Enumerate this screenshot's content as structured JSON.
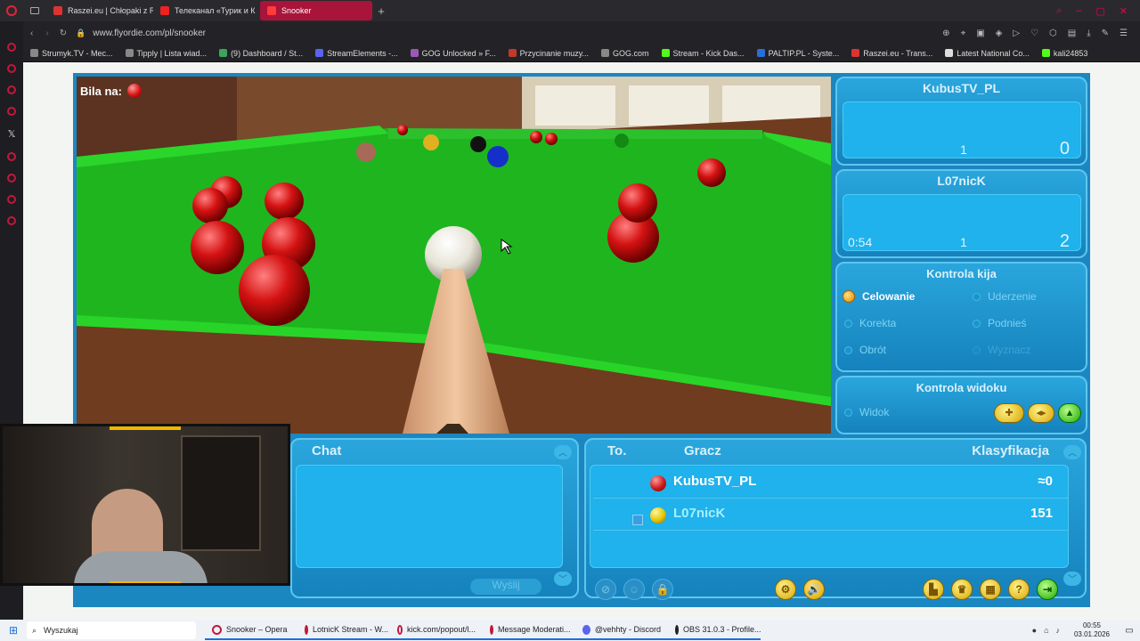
{
  "tabs": [
    {
      "label": "Raszei.eu | Chłopaki z Ra",
      "color": "#d33"
    },
    {
      "label": "Телеканал «Турик и К",
      "color": "#e22"
    },
    {
      "label": "Snooker",
      "color": "#e22",
      "active": true
    }
  ],
  "address": {
    "url": "www.flyordie.com/pl/snooker"
  },
  "bookmarks": [
    "Strumyk.TV - Mec...",
    "Tipply | Lista wiad...",
    "(9) Dashboard / St...",
    "StreamElements -...",
    "GOG Unlocked » F...",
    "Przycinanie muzy...",
    "GOG.com",
    "Stream - Kick Das...",
    "PALTIP.PL - Syste...",
    "Raszei.eu - Trans...",
    "Latest National Co...",
    "kali24853"
  ],
  "game": {
    "ball_on_label": "Bila na:",
    "player1": {
      "name": "KubusTV_PL",
      "frames": "1",
      "score": "0"
    },
    "player2": {
      "name": "L07nicK",
      "timer": "0:54",
      "frames": "1",
      "score": "2"
    },
    "cue_control": {
      "title": "Kontrola kija",
      "options": [
        "Celowanie",
        "Uderzenie",
        "Korekta",
        "Podnieś",
        "Obrót",
        "Wyznacz"
      ]
    },
    "view_control": {
      "title": "Kontrola widoku",
      "option": "Widok"
    },
    "chat": {
      "title": "Chat",
      "send_label": "Wyślij"
    },
    "table": {
      "headers": [
        "To.",
        "Gracz",
        "Klasyfikacja"
      ],
      "rows": [
        {
          "ball": "#cc1a1a",
          "name": "KubusTV_PL",
          "rating": "≈0"
        },
        {
          "ball": "#e5c400",
          "name": "L07nicK",
          "rating": "151"
        }
      ]
    }
  },
  "taskbar": {
    "search": "Wyszukaj",
    "items": [
      "Snooker – Opera",
      "LotnicK Stream - W...",
      "kick.com/popout/l...",
      "Message Moderati...",
      "@vehhty - Discord",
      "OBS 31.0.3 - Profile..."
    ],
    "time": "00:55",
    "date": "03.01.2026"
  }
}
